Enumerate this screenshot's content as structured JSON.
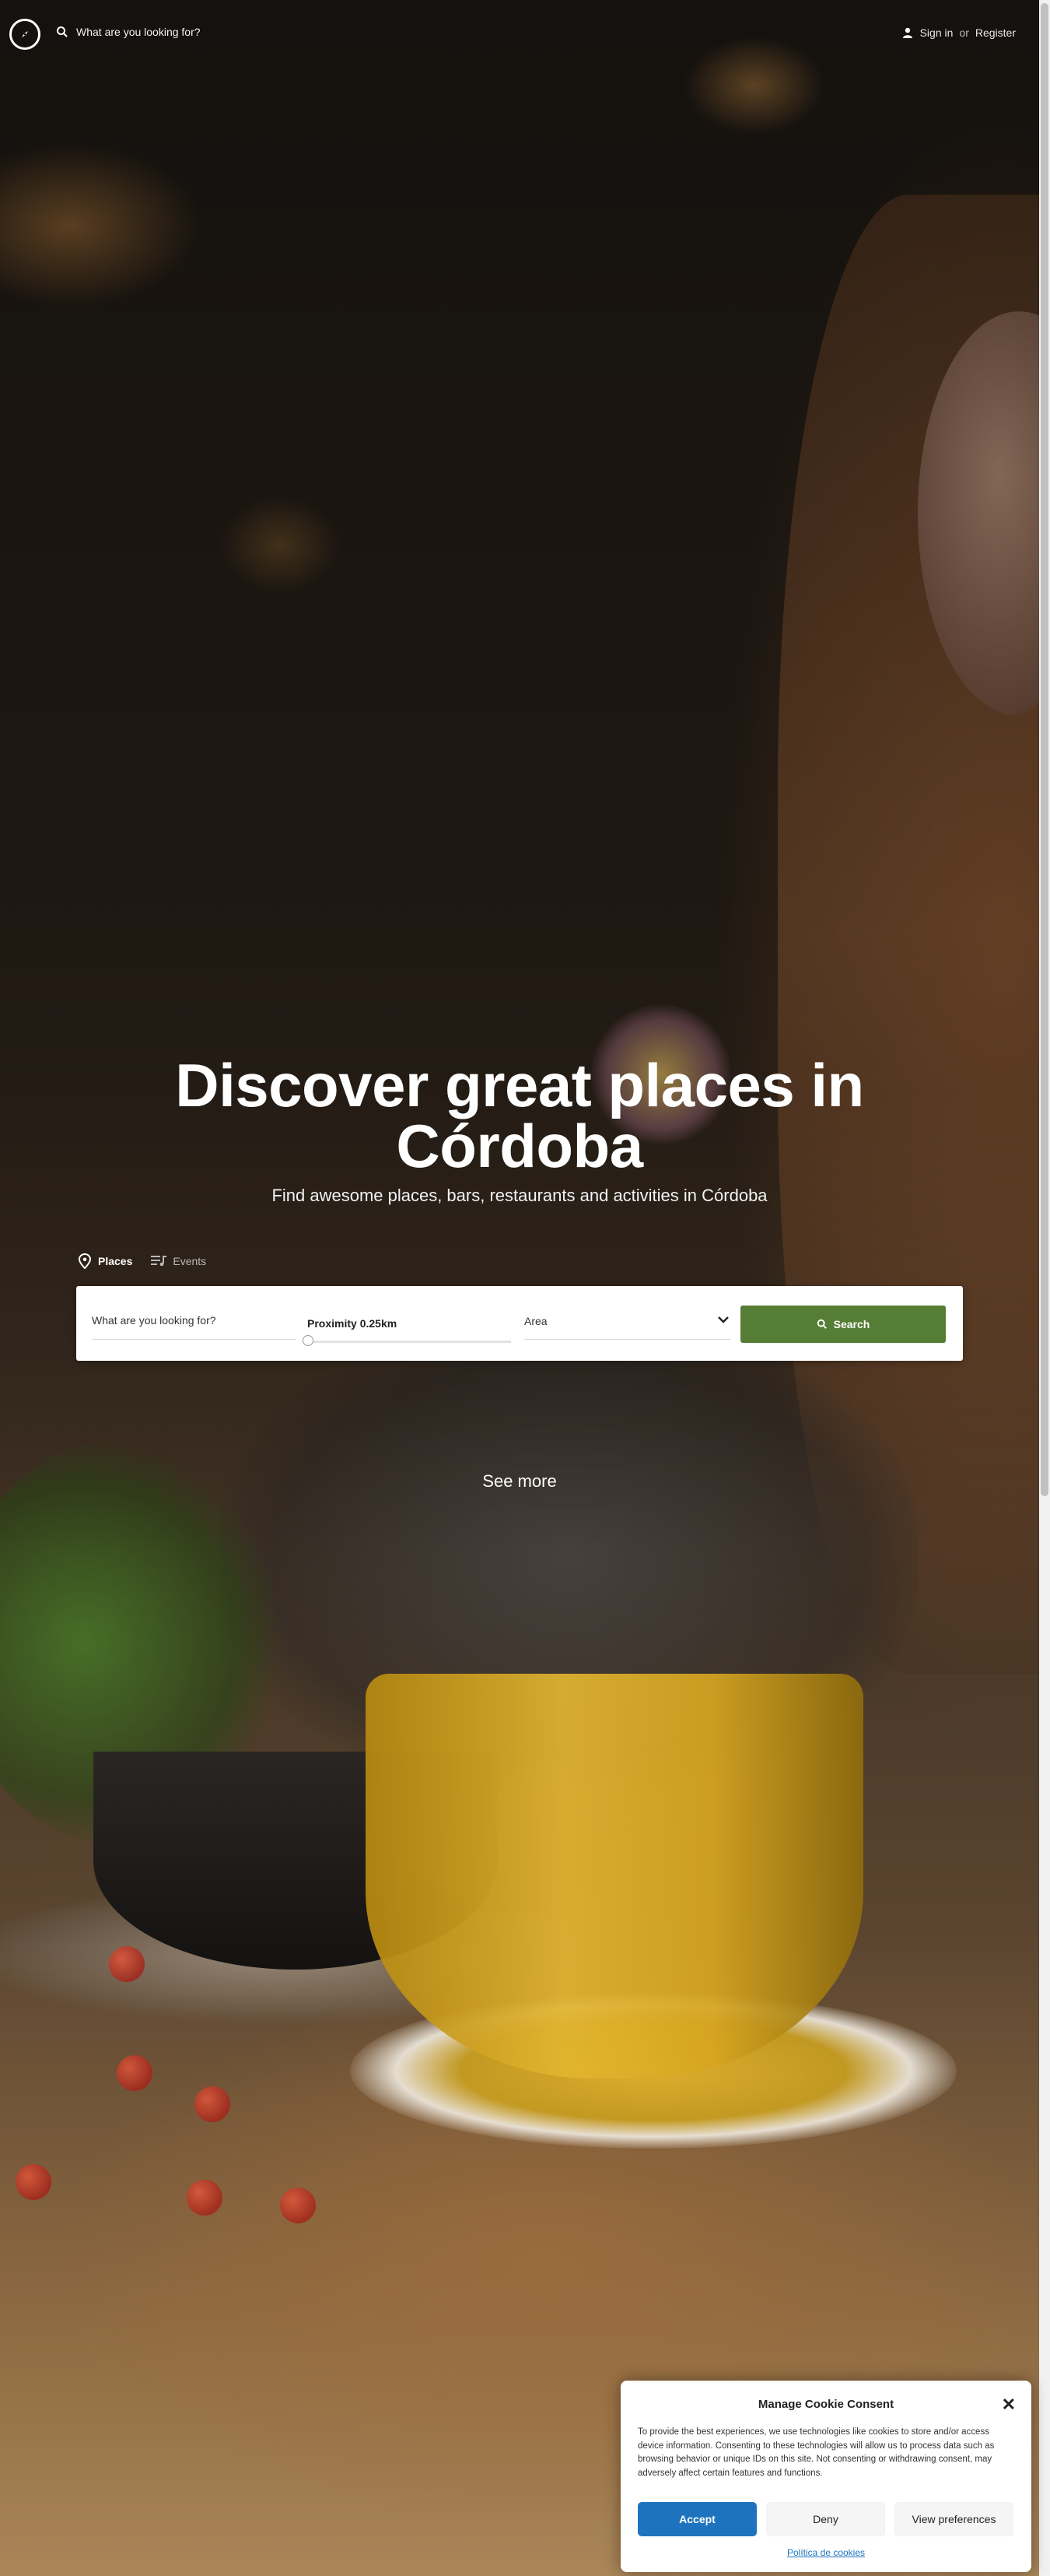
{
  "header": {
    "search_placeholder": "What are you looking for?",
    "sign_in": "Sign in",
    "or": "or",
    "register": "Register"
  },
  "hero": {
    "title_line1": "Discover great places in",
    "title_line2": "Córdoba",
    "subtitle": "Find awesome places, bars, restaurants and activities in Córdoba"
  },
  "tabs": [
    {
      "label": "Places",
      "icon": "map-pin-icon",
      "active": true
    },
    {
      "label": "Events",
      "icon": "playlist-icon",
      "active": false
    }
  ],
  "search_panel": {
    "keyword_placeholder": "What are you looking for?",
    "proximity_label": "Proximity 0.25km",
    "proximity_value_km": 0.25,
    "area_label": "Area",
    "search_button": "Search"
  },
  "see_more": "See more",
  "cookie": {
    "title": "Manage Cookie Consent",
    "body": "To provide the best experiences, we use technologies like cookies to store and/or access device information. Consenting to these technologies will allow us to process data such as browsing behavior or unique IDs on this site. Not consenting or withdrawing consent, may adversely affect certain features and functions.",
    "accept": "Accept",
    "deny": "Deny",
    "preferences": "View preferences",
    "policy_link": "Política de cookies"
  },
  "colors": {
    "search_button": "#567d35",
    "accept_button": "#1e73be"
  }
}
